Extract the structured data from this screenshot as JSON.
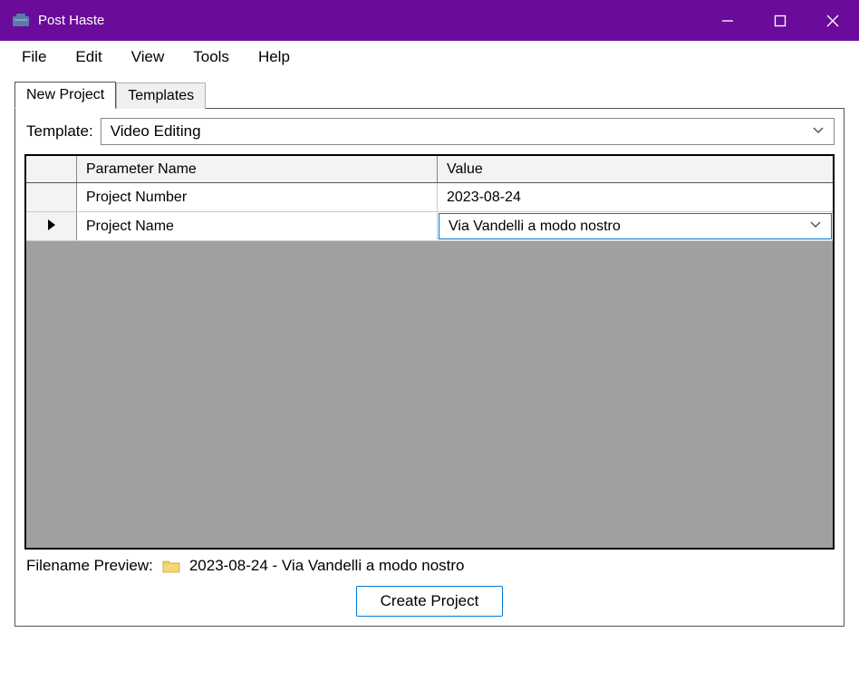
{
  "window": {
    "title": "Post Haste"
  },
  "menu": {
    "file": "File",
    "edit": "Edit",
    "view": "View",
    "tools": "Tools",
    "help": "Help"
  },
  "tabs": {
    "new_project": "New Project",
    "templates": "Templates"
  },
  "template": {
    "label": "Template:",
    "selected": "Video Editing"
  },
  "grid": {
    "headers": {
      "parameter": "Parameter Name",
      "value": "Value"
    },
    "rows": [
      {
        "param": "Project Number",
        "value": "2023-08-24",
        "active": false
      },
      {
        "param": "Project Name",
        "value": "Via Vandelli a modo nostro",
        "active": true
      }
    ]
  },
  "preview": {
    "label": "Filename Preview:",
    "filename": "2023-08-24 - Via Vandelli a modo nostro"
  },
  "buttons": {
    "create": "Create Project"
  }
}
